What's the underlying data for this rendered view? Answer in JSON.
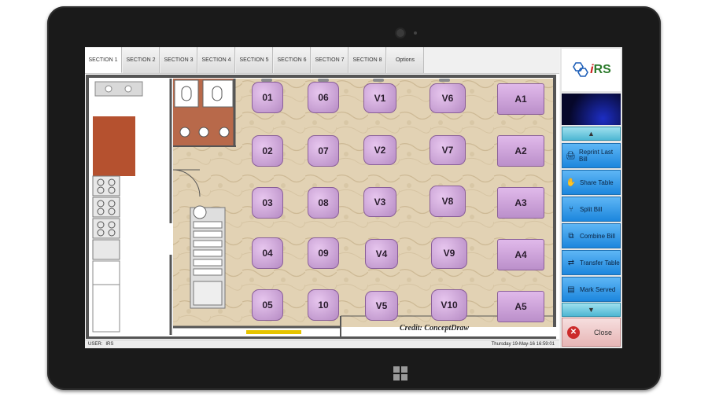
{
  "tabs": [
    "SECTION 1",
    "SECTION 2",
    "SECTION 3",
    "SECTION 4",
    "SECTION 5",
    "SECTION 6",
    "SECTION 7",
    "SECTION 8",
    "Options"
  ],
  "active_tab": "SECTION 1",
  "tables": {
    "col1": [
      "01",
      "02",
      "03",
      "04",
      "05"
    ],
    "col2": [
      "06",
      "07",
      "08",
      "09",
      "10"
    ],
    "col3": [
      "V1",
      "V2",
      "V3",
      "V4",
      "V5"
    ],
    "col4": [
      "V6",
      "V7",
      "V8",
      "V9",
      "V10"
    ],
    "col5": [
      "A1",
      "A2",
      "A3",
      "A4",
      "A5"
    ]
  },
  "credit": "Credit: ConceptDraw",
  "status": {
    "user_label": "USER:",
    "user": "IRS",
    "datetime": "Thursday 19-May-16  16:59:01"
  },
  "logo": {
    "prefix": "i",
    "text": "RS"
  },
  "actions": [
    "Reprint Last Bill",
    "Share Table",
    "Split Bill",
    "Combine Bill",
    "Transfer Table",
    "Mark Served"
  ],
  "action_icons": [
    "printer-icon",
    "hand-icon",
    "split-icon",
    "combine-icon",
    "transfer-icon",
    "notepad-icon"
  ],
  "close_label": "Close",
  "colors": {
    "table_fill": "#c9a2d6",
    "action_button": "#3a9ee9",
    "close_icon": "#cc2a2a",
    "tab_active": "#ffffff"
  }
}
